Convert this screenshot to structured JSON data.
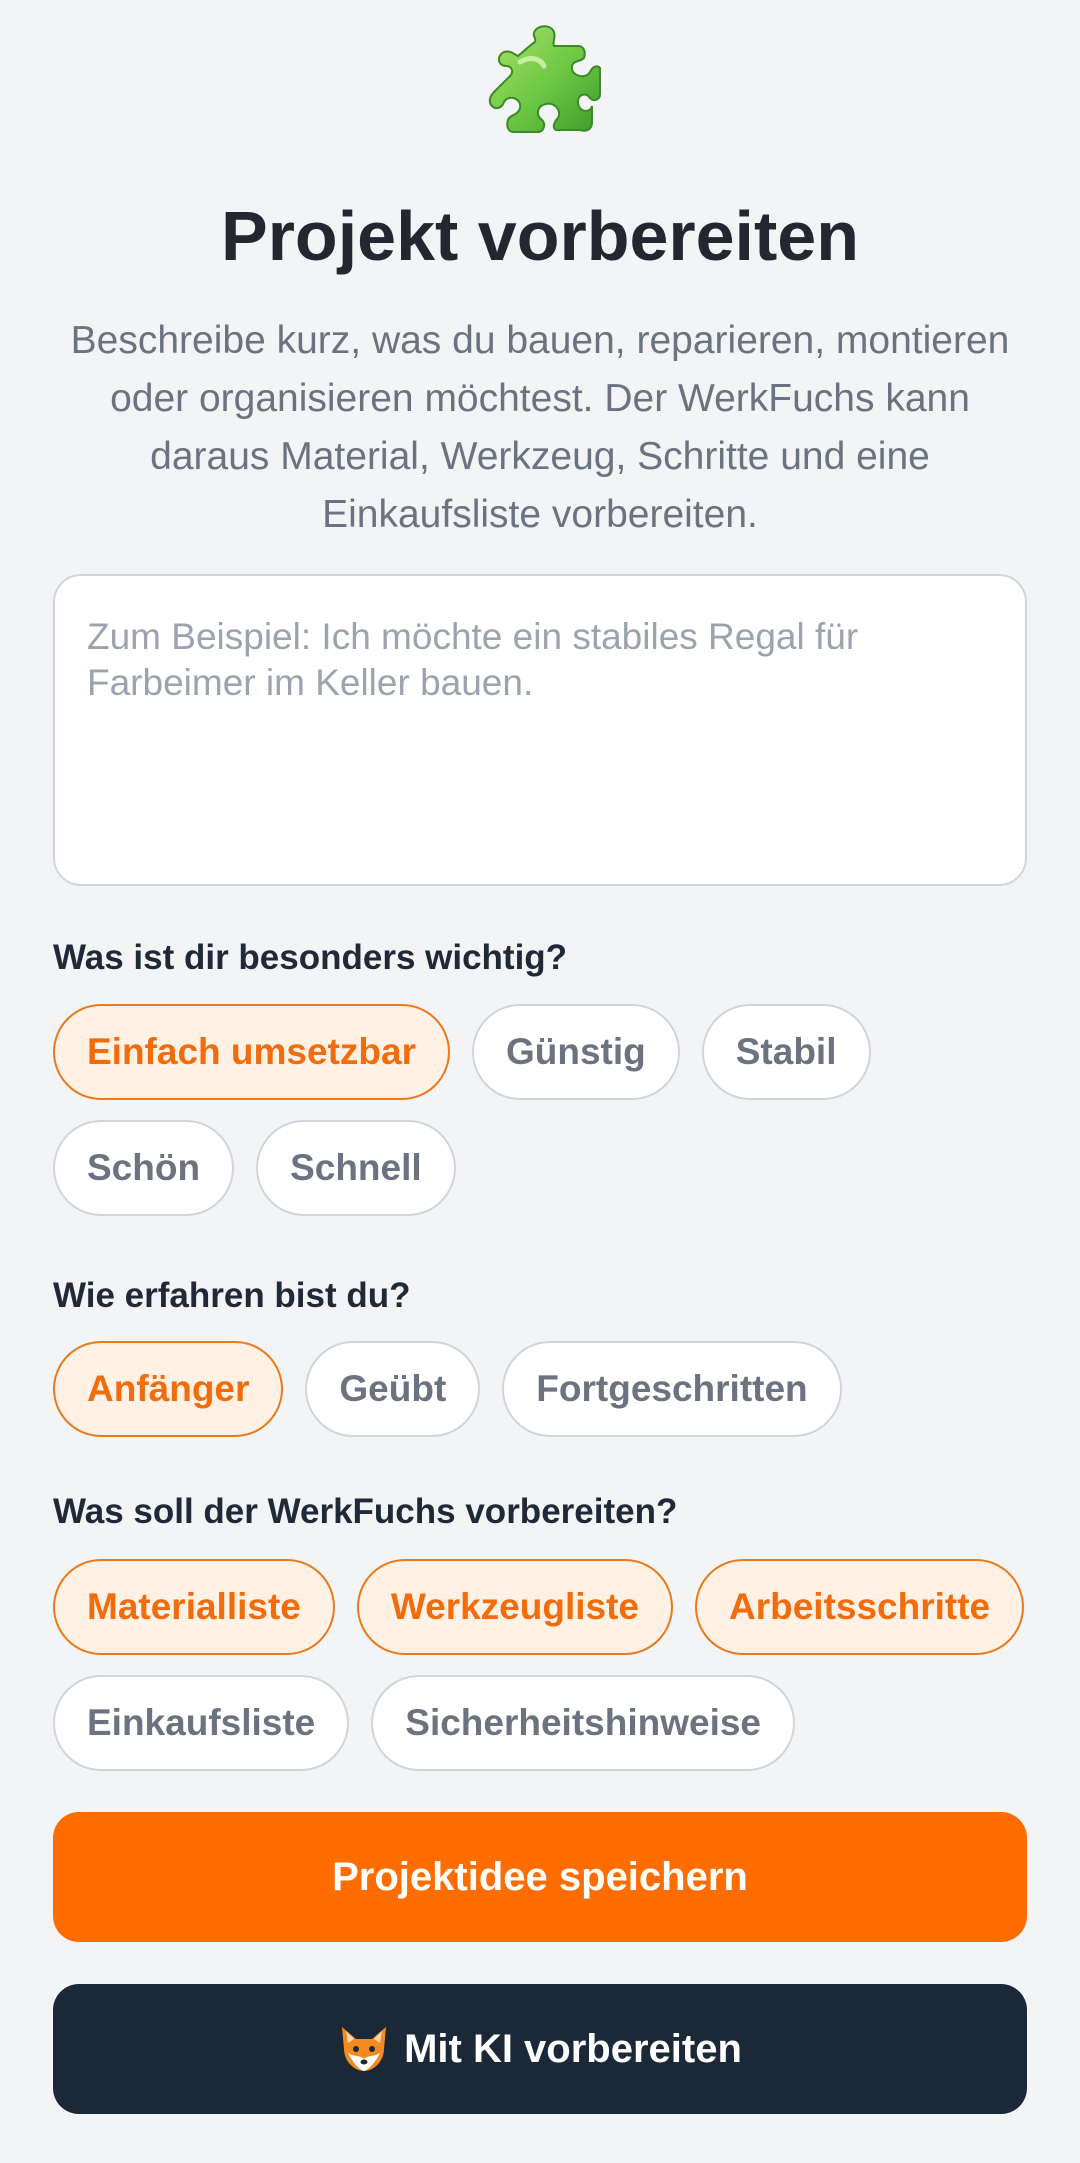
{
  "header": {
    "icon": "puzzle-piece-icon",
    "title": "Projekt vorbereiten",
    "subtitle": "Beschreibe kurz, was du bauen, reparieren, montieren oder organisieren möchtest. Der WerkFuchs kann daraus Material, Werkzeug, Schritte und eine Einkaufsliste vorbereiten."
  },
  "description_input": {
    "value": "",
    "placeholder": "Zum Beispiel: Ich möchte ein stabiles Regal für Farbeimer im Keller bauen."
  },
  "priorities": {
    "label": "Was ist dir besonders wichtig?",
    "options": [
      {
        "label": "Einfach umsetzbar",
        "selected": true
      },
      {
        "label": "Günstig",
        "selected": false
      },
      {
        "label": "Stabil",
        "selected": false
      },
      {
        "label": "Schön",
        "selected": false
      },
      {
        "label": "Schnell",
        "selected": false
      }
    ]
  },
  "experience": {
    "label": "Wie erfahren bist du?",
    "options": [
      {
        "label": "Anfänger",
        "selected": true
      },
      {
        "label": "Geübt",
        "selected": false
      },
      {
        "label": "Fortgeschritten",
        "selected": false
      }
    ]
  },
  "outputs": {
    "label": "Was soll der WerkFuchs vorbereiten?",
    "options": [
      {
        "label": "Materialliste",
        "selected": true
      },
      {
        "label": "Werkzeugliste",
        "selected": true
      },
      {
        "label": "Arbeitsschritte",
        "selected": true
      },
      {
        "label": "Einkaufsliste",
        "selected": false
      },
      {
        "label": "Sicherheitshinweise",
        "selected": false
      }
    ]
  },
  "actions": {
    "save_label": "Projektidee speichern",
    "ai_label": "Mit KI vorbereiten",
    "ai_icon": "fox-face-icon"
  },
  "colors": {
    "accent": "#ff6d00",
    "accent_text": "#f26c0c",
    "accent_bg": "#fff1e4",
    "dark_button": "#1b2838",
    "background": "#f3f4f6"
  }
}
